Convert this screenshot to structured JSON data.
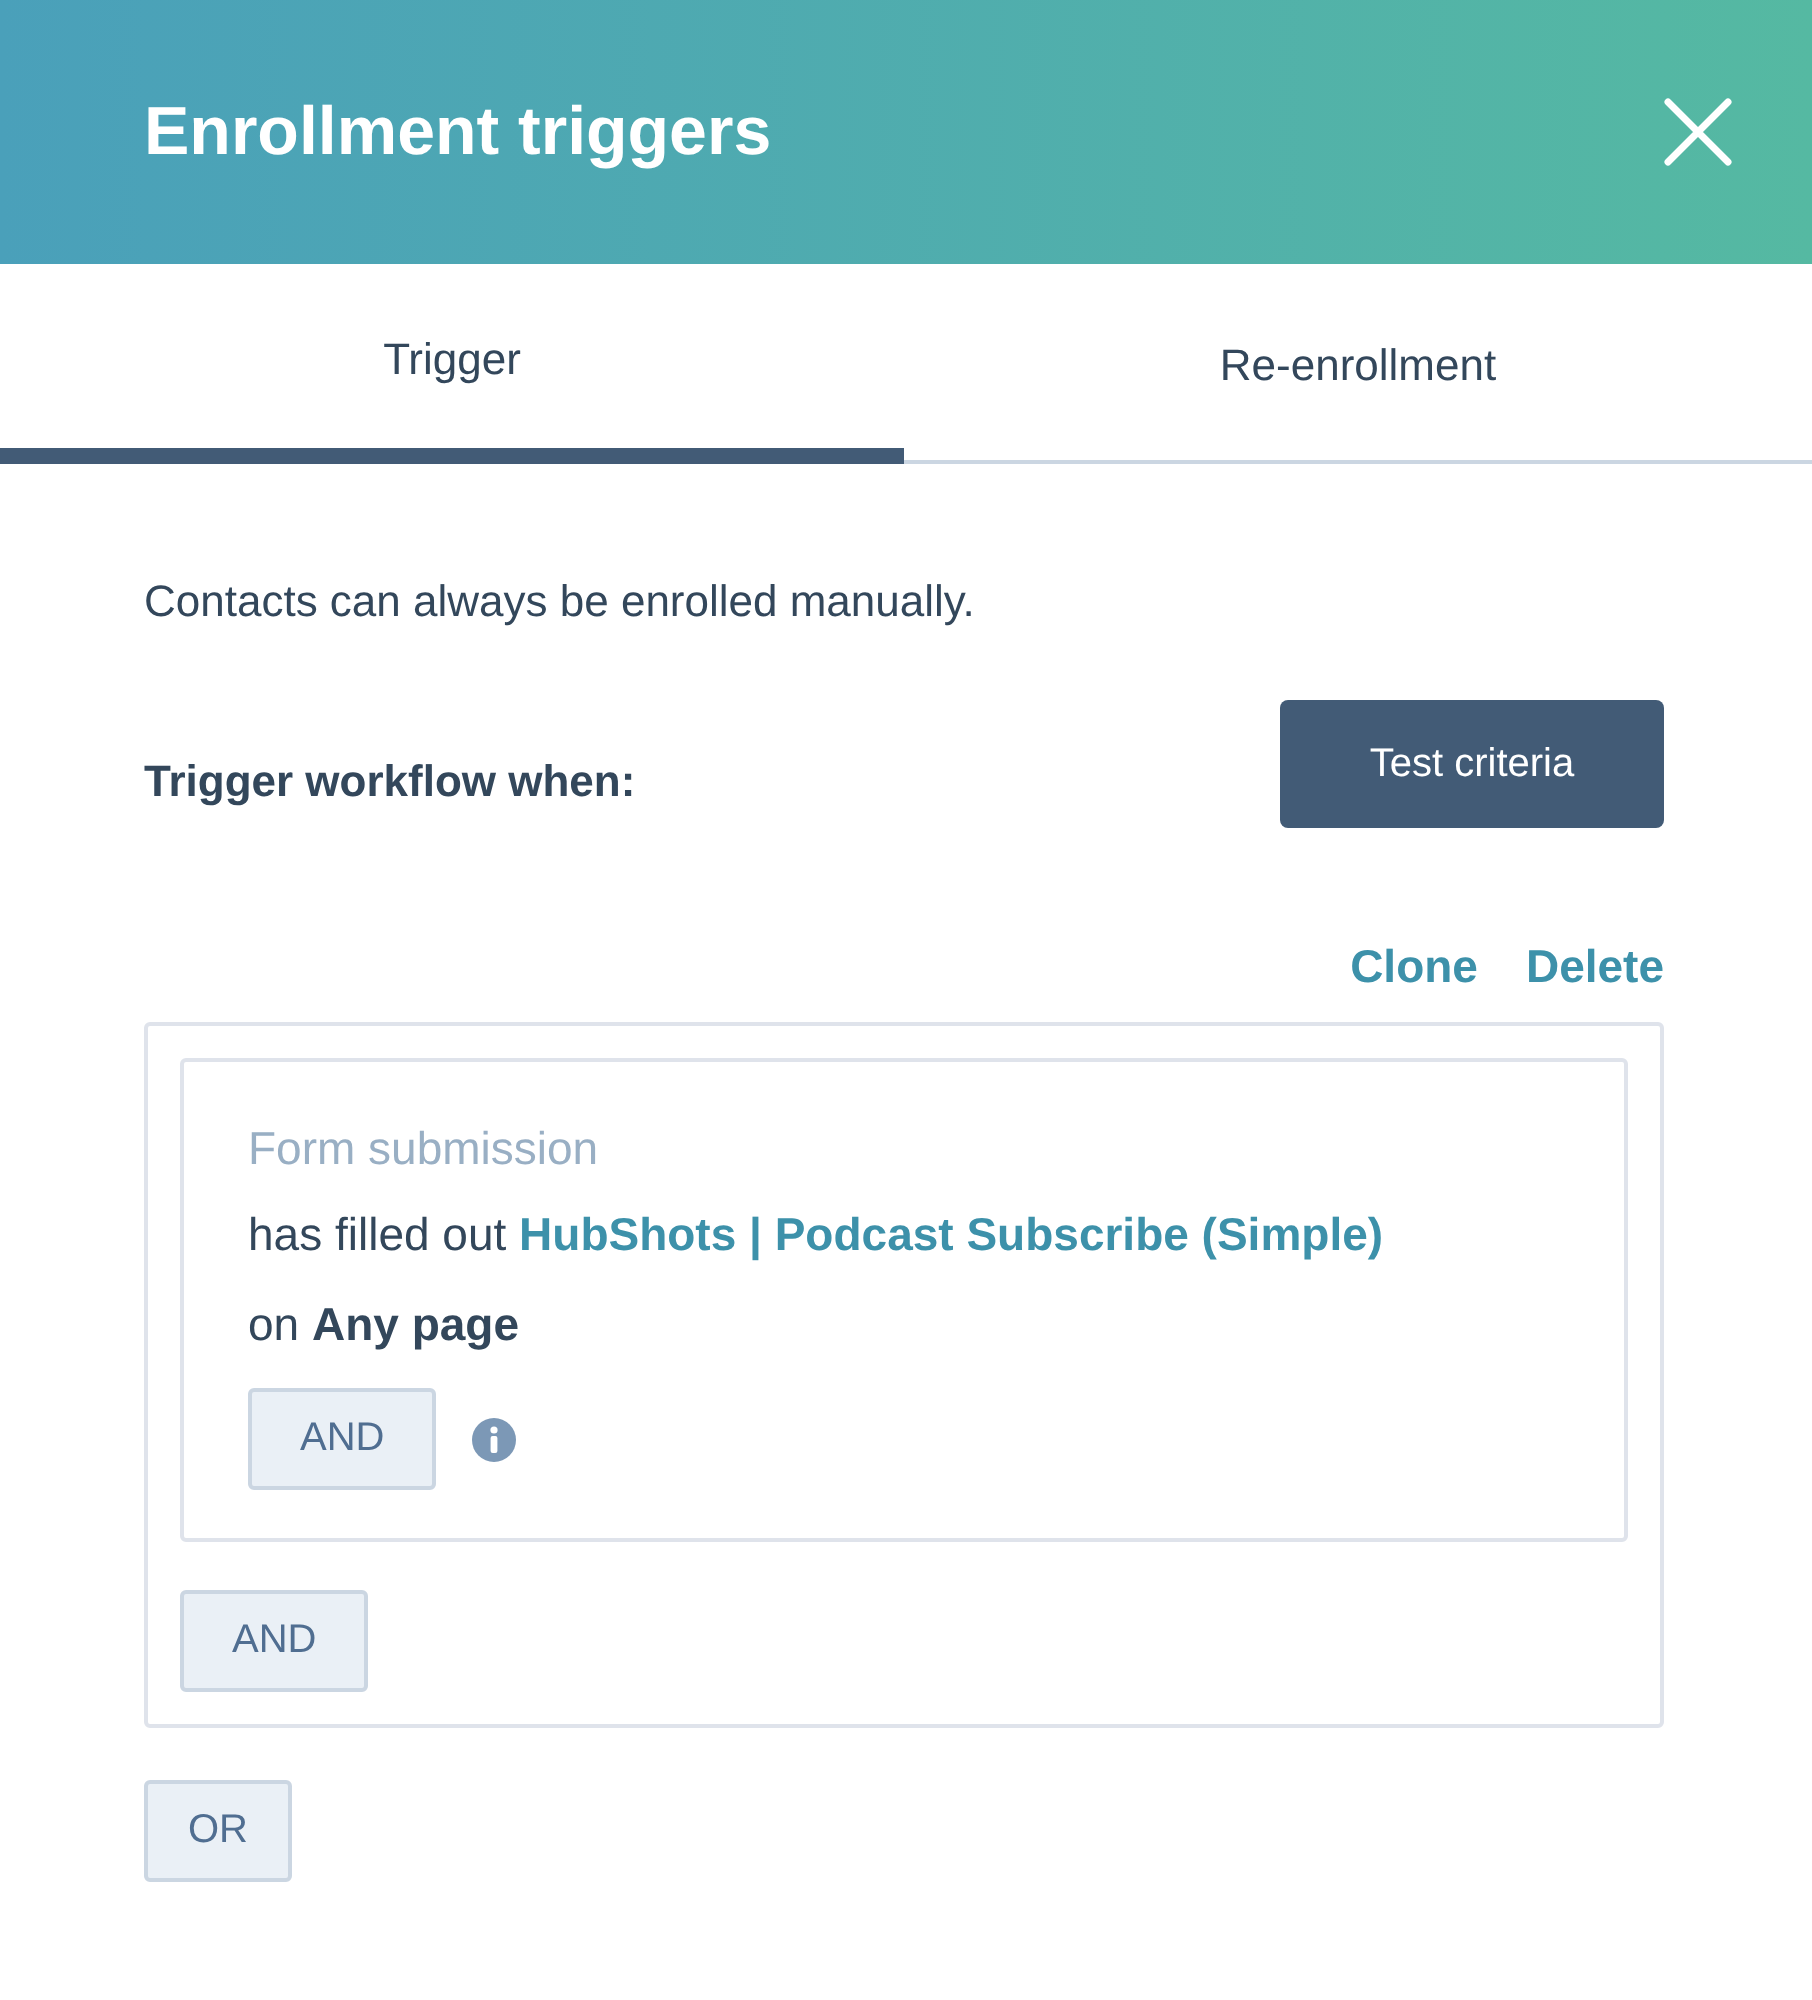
{
  "header": {
    "title": "Enrollment triggers"
  },
  "tabs": [
    {
      "label": "Trigger",
      "selected": true
    },
    {
      "label": "Re-enrollment",
      "selected": false
    }
  ],
  "note": "Contacts can always be enrolled manually.",
  "trigger_label": "Trigger workflow when:",
  "test_button": "Test criteria",
  "group_actions": [
    "Clone",
    "Delete"
  ],
  "filter": {
    "category": "Form submission",
    "condition": "has filled out",
    "form_link": "HubShots | Podcast Subscribe (Simple)",
    "location": "on **Any page**",
    "and_button": "AND"
  },
  "group_and_button": "AND",
  "or_button": "OR"
}
